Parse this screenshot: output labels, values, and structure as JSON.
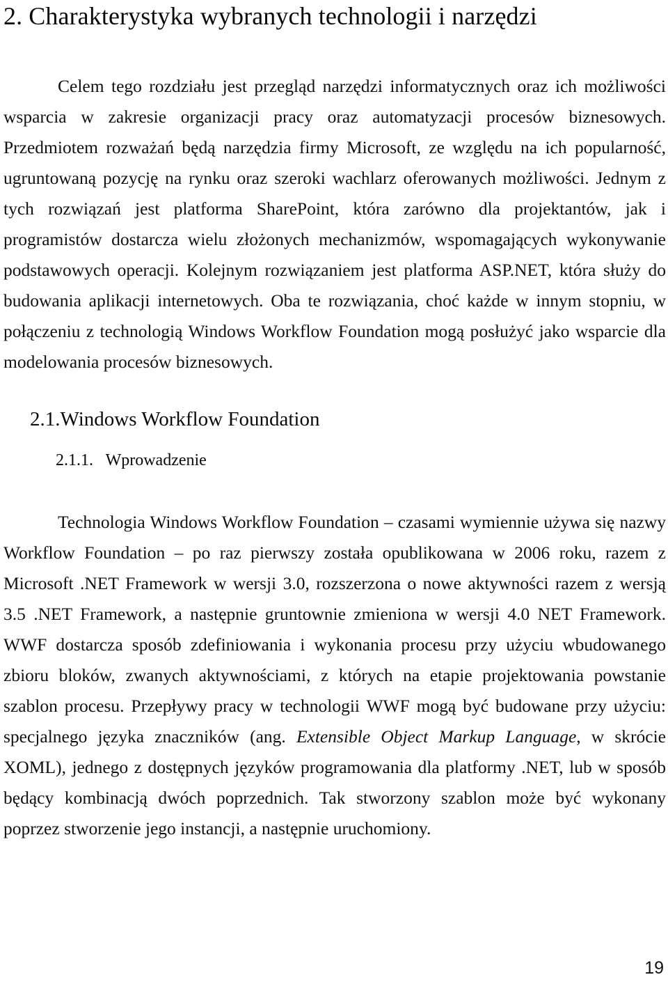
{
  "document": {
    "language": "pl",
    "page_number": "19",
    "text_color": "#111111",
    "background_color": "#ffffff"
  },
  "chapter_heading": {
    "number": "2.",
    "title": "Charakterystyka wybranych technologii i narzędzi",
    "full": "2. Charakterystyka wybranych technologii i narzędzi"
  },
  "paragraphs": {
    "intro": "Celem tego rozdziału jest przegląd narzędzi informatycznych oraz ich możliwości wsparcia w zakresie organizacji pracy oraz automatyzacji procesów biznesowych. Przedmiotem rozważań będą narzędzia firmy Microsoft, ze względu na ich popularność, ugruntowaną pozycję na rynku oraz szeroki wachlarz oferowanych możliwości. Jednym z tych rozwiązań jest platforma SharePoint, która zarówno dla projektantów, jak i programistów dostarcza wielu złożonych mechanizmów, wspomagających wykonywanie podstawowych operacji. Kolejnym rozwiązaniem jest platforma ASP.NET, która służy do budowania aplikacji internetowych. Oba te rozwiązania, choć każde w innym stopniu, w połączeniu z technologią Windows Workflow Foundation mogą posłużyć jako wsparcie dla modelowania procesów biznesowych.",
    "wwf_intro_part1": "Technologia Windows Workflow Foundation – czasami wymiennie używa się nazwy Workflow Foundation – po raz pierwszy została opublikowana w 2006 roku, razem z Microsoft .NET Framework w wersji 3.0, rozszerzona o nowe aktywności razem z wersją 3.5 .NET Framework, a następnie gruntownie zmieniona w wersji 4.0 NET Framework. WWF dostarcza sposób zdefiniowania i wykonania procesu przy użyciu wbudowanego zbioru bloków, zwanych aktywnościami, z których na etapie projektowania powstanie szablon procesu. Przepływy pracy w technologii WWF mogą być budowane przy użyciu: specjalnego języka znaczników (ang. ",
    "wwf_intro_italic1": "Extensible Object Markup Language",
    "wwf_intro_part2": ", w skrócie XOML), jednego z dostępnych języków programowania dla platformy .NET, lub w sposób będący kombinacją dwóch poprzednich. Tak stworzony szablon może być wykonany poprzez stworzenie jego instancji, a następnie uruchomiony."
  },
  "section_heading": {
    "number": "2.1.",
    "title": "Windows Workflow Foundation",
    "full": "2.1.Windows Workflow Foundation"
  },
  "subsection_heading": {
    "number": "2.1.1.",
    "title": "Wprowadzenie",
    "full": "2.1.1.   Wprowadzenie"
  }
}
